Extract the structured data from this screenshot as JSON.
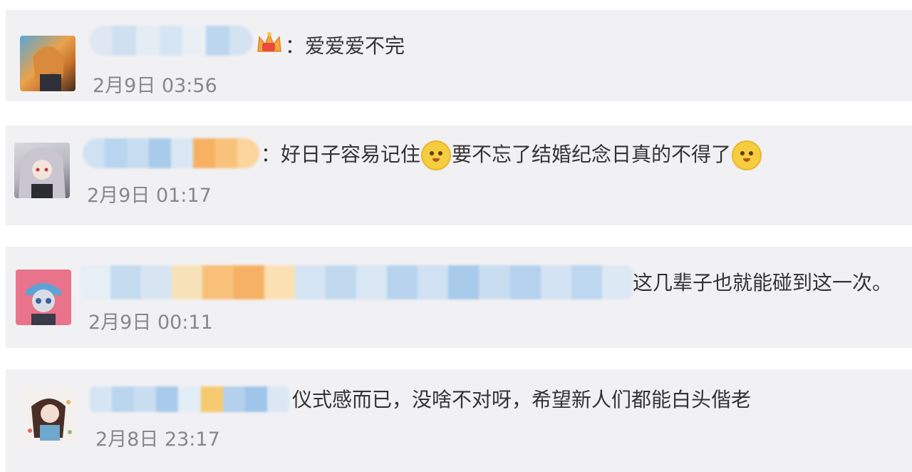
{
  "comments": [
    {
      "text": "：爱爱爱不完",
      "time": "2月9日 03:56"
    },
    {
      "text_a": "：好日子容易记住",
      "text_b": "要不忘了结婚纪念日真的不得了",
      "time": "2月9日 01:17"
    },
    {
      "text": "这几辈子也就能碰到这一次。",
      "time": "2月9日 00:11"
    },
    {
      "text": "仪式感而已，没啥不对呀，希望新人们都能白头偕老",
      "time": "2月8日 23:17"
    }
  ],
  "icons": {
    "crown": "crown-badge-icon",
    "emoji": "doge-emoji-icon"
  },
  "colors": {
    "card_bg": "#f1f1f4",
    "time": "#888888",
    "text": "#333333"
  }
}
